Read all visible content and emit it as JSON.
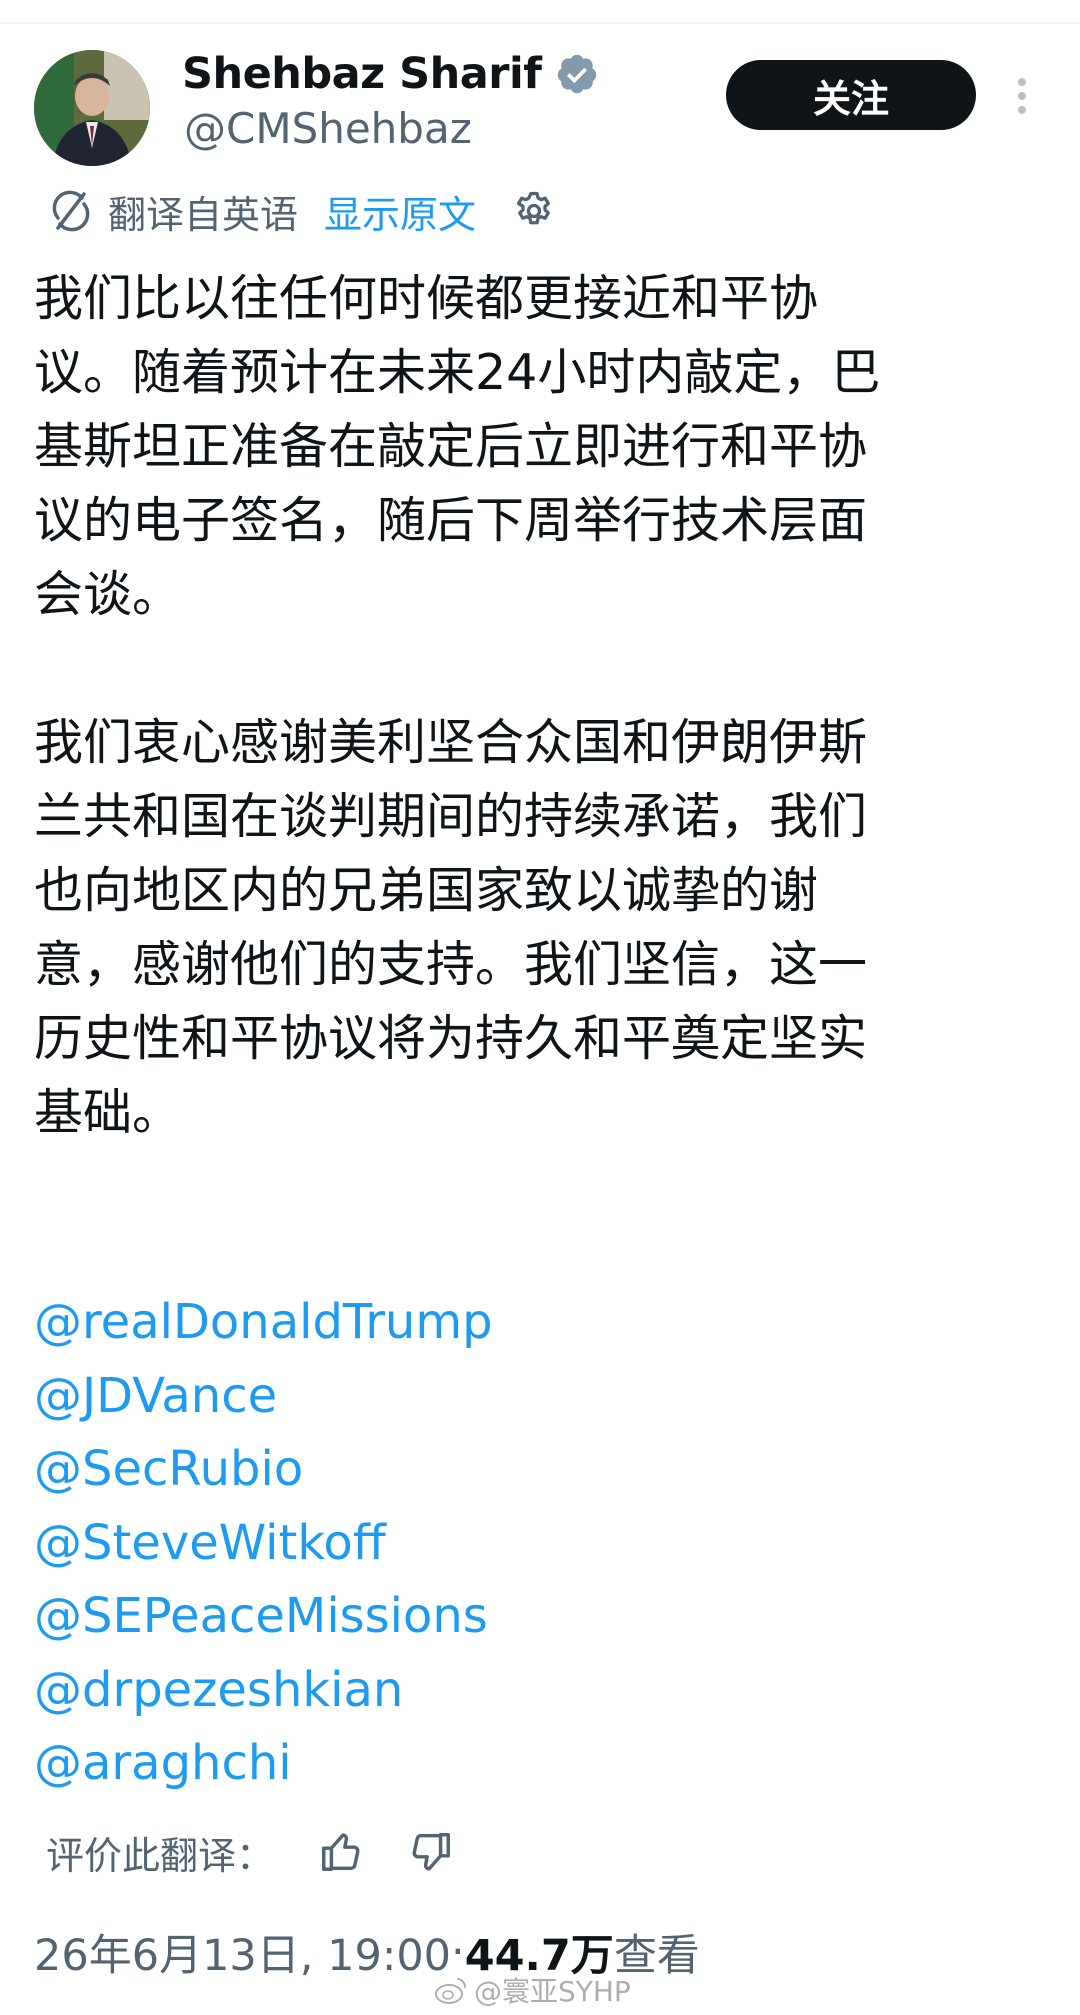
{
  "tweet": {
    "display_name": "Shehbaz Sharif",
    "handle": "@CMShehbaz",
    "follow_label": "关注",
    "translation_bar": {
      "translated_from": "翻译自英语",
      "show_original": "显示原文"
    },
    "body_paragraphs": [
      [
        "我们比以往任何时候都更接近和平协",
        "议。随着预计在未来24小时内敲定，巴",
        "基斯坦正准备在敲定后立即进行和平协",
        "议的电子签名，随后下周举行技术层面",
        "会谈。"
      ],
      [
        "我们衷心感谢美利坚合众国和伊朗伊斯",
        "兰共和国在谈判期间的持续承诺，我们",
        "也向地区内的兄弟国家致以诚挚的谢",
        "意，感谢他们的支持。我们坚信，这一",
        "历史性和平协议将为持久和平奠定坚实",
        "基础。"
      ]
    ],
    "mentions": [
      "@realDonaldTrump",
      "@JDVance",
      "@SecRubio",
      "@SteveWitkoff",
      "@SEPeaceMissions",
      "@drpezeshkian",
      "@araghchi"
    ],
    "rate_translation_label": "评价此翻译：",
    "timestamp": "26年6月13日, 19:00",
    "separator": " · ",
    "views_count": "44.7万",
    "views_label": " 查看"
  },
  "watermark": {
    "text": "@寰亚SYHP",
    "icon": "weibo-icon"
  },
  "icons": {
    "verified": "verified-badge-icon",
    "more": "more-vertical-icon",
    "translate": "translate-icon",
    "settings": "gear-icon",
    "thumbs_up": "thumbs-up-icon",
    "thumbs_down": "thumbs-down-icon"
  },
  "colors": {
    "text_primary": "#0f1419",
    "text_secondary": "#536471",
    "link": "#1d9bf0",
    "follow_button_bg": "#0f1419"
  }
}
